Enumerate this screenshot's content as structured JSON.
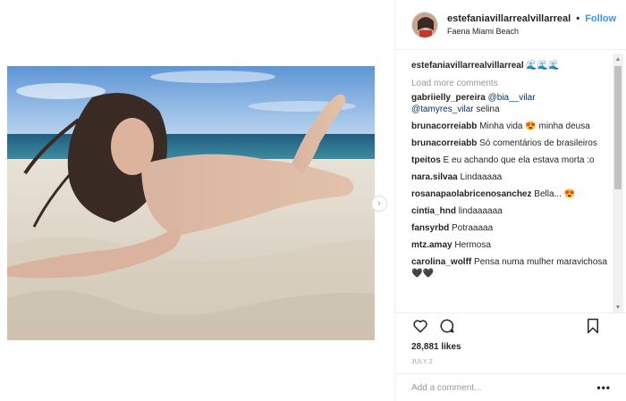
{
  "post": {
    "username": "estefaniavillarrealvillarreal",
    "follow_label": "Follow",
    "dot": "•",
    "location": "Faena Miami Beach",
    "caption_user": "estefaniavillarrealvillarreal",
    "caption_text": "🌊🌊🌊",
    "load_more": "Load more comments",
    "likes": "28,881 likes",
    "date": "JULY 2",
    "add_comment_placeholder": "Add a comment...",
    "more_options": "•••"
  },
  "comments": [
    {
      "user": "gabriielly_pereira",
      "mention1": "@bia__vilar",
      "mention2": "@tamyres_vilar",
      "text": " selina"
    },
    {
      "user": "brunacorreiabb",
      "text": " Minha vida 😍 minha deusa"
    },
    {
      "user": "brunacorreiabb",
      "text": " Só comentários de brasileiros"
    },
    {
      "user": "tpeitos",
      "text": " E eu achando que ela estava morta :o"
    },
    {
      "user": "nara.silvaa",
      "text": " Lindaaaaa"
    },
    {
      "user": "rosanapaolabricenosanchez",
      "text": " Bella... 😍"
    },
    {
      "user": "cintia_hnd",
      "text": " lindaaaaaa"
    },
    {
      "user": "fansyrbd",
      "text": " Potraaaaa"
    },
    {
      "user": "mtz.amay",
      "text": " Hermosa"
    },
    {
      "user": "carolina_wolff",
      "text": " Pensa numa mulher maravichosa 🖤🖤"
    }
  ],
  "icons": {
    "like": "heart-icon",
    "comment": "comment-bubble-icon",
    "save": "bookmark-icon",
    "next": "chevron-right-icon"
  },
  "colors": {
    "follow": "#3897f0",
    "muted": "#999999",
    "text": "#262626",
    "mention": "#003569"
  }
}
